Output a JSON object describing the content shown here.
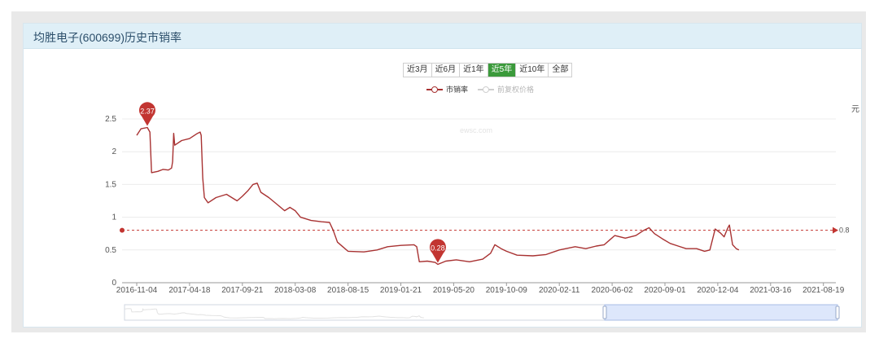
{
  "panel": {
    "title": "均胜电子(600699)历史市销率"
  },
  "range_buttons": [
    {
      "label": "近3月",
      "active": false
    },
    {
      "label": "近6月",
      "active": false
    },
    {
      "label": "近1年",
      "active": false
    },
    {
      "label": "近5年",
      "active": true
    },
    {
      "label": "近10年",
      "active": false
    },
    {
      "label": "全部",
      "active": false
    }
  ],
  "legend": [
    {
      "label": "市销率",
      "active": true
    },
    {
      "label": "前复权价格",
      "active": false
    }
  ],
  "right_axis_unit": "元",
  "watermark": "ewsc.com",
  "colors": {
    "series": "#a83232",
    "marker": "#c23531",
    "inactive": "#cfcfcf",
    "active_button": "#3b9a3b",
    "selection": "#dde7fb"
  },
  "chart_data": {
    "type": "line",
    "ylim": [
      0,
      2.5
    ],
    "y_ticks": [
      "0",
      "0.5",
      "1",
      "1.5",
      "2",
      "2.5"
    ],
    "x_ticks": [
      "2016-11-04",
      "2017-04-18",
      "2017-09-21",
      "2018-03-08",
      "2018-08-15",
      "2019-01-21",
      "2019-05-20",
      "2019-10-09",
      "2020-02-11",
      "2020-06-02",
      "2020-09-01",
      "2020-12-04",
      "2021-03-16",
      "2021-08-19"
    ],
    "series": [
      {
        "name": "市销率",
        "points": [
          [
            0,
            2.25
          ],
          [
            0.08,
            2.35
          ],
          [
            0.2,
            2.37
          ],
          [
            0.25,
            2.3
          ],
          [
            0.28,
            1.68
          ],
          [
            0.4,
            1.7
          ],
          [
            0.5,
            1.73
          ],
          [
            0.6,
            1.72
          ],
          [
            0.66,
            1.75
          ],
          [
            0.68,
            1.85
          ],
          [
            0.7,
            2.28
          ],
          [
            0.72,
            2.1
          ],
          [
            0.85,
            2.17
          ],
          [
            1.0,
            2.2
          ],
          [
            1.15,
            2.28
          ],
          [
            1.2,
            2.3
          ],
          [
            1.22,
            2.25
          ],
          [
            1.25,
            1.6
          ],
          [
            1.28,
            1.3
          ],
          [
            1.35,
            1.22
          ],
          [
            1.5,
            1.3
          ],
          [
            1.7,
            1.35
          ],
          [
            1.8,
            1.3
          ],
          [
            1.9,
            1.25
          ],
          [
            2.0,
            1.32
          ],
          [
            2.1,
            1.4
          ],
          [
            2.2,
            1.5
          ],
          [
            2.28,
            1.52
          ],
          [
            2.35,
            1.38
          ],
          [
            2.5,
            1.3
          ],
          [
            2.65,
            1.2
          ],
          [
            2.8,
            1.1
          ],
          [
            2.9,
            1.15
          ],
          [
            3.0,
            1.1
          ],
          [
            3.1,
            1.0
          ],
          [
            3.3,
            0.95
          ],
          [
            3.5,
            0.93
          ],
          [
            3.65,
            0.92
          ],
          [
            3.72,
            0.8
          ],
          [
            3.8,
            0.62
          ],
          [
            3.9,
            0.55
          ],
          [
            4.0,
            0.48
          ],
          [
            4.3,
            0.47
          ],
          [
            4.55,
            0.5
          ],
          [
            4.75,
            0.55
          ],
          [
            5.0,
            0.57
          ],
          [
            5.25,
            0.58
          ],
          [
            5.3,
            0.55
          ],
          [
            5.35,
            0.32
          ],
          [
            5.5,
            0.33
          ],
          [
            5.65,
            0.31
          ],
          [
            5.7,
            0.28
          ],
          [
            5.85,
            0.33
          ],
          [
            6.05,
            0.35
          ],
          [
            6.3,
            0.32
          ],
          [
            6.55,
            0.36
          ],
          [
            6.7,
            0.45
          ],
          [
            6.78,
            0.58
          ],
          [
            6.9,
            0.52
          ],
          [
            7.0,
            0.48
          ],
          [
            7.2,
            0.42
          ],
          [
            7.5,
            0.41
          ],
          [
            7.75,
            0.43
          ],
          [
            8.0,
            0.5
          ],
          [
            8.3,
            0.55
          ],
          [
            8.5,
            0.52
          ],
          [
            8.7,
            0.56
          ],
          [
            8.85,
            0.58
          ],
          [
            8.95,
            0.65
          ],
          [
            9.05,
            0.72
          ],
          [
            9.25,
            0.68
          ],
          [
            9.45,
            0.72
          ],
          [
            9.6,
            0.8
          ],
          [
            9.7,
            0.84
          ],
          [
            9.8,
            0.75
          ],
          [
            9.95,
            0.67
          ],
          [
            10.1,
            0.6
          ],
          [
            10.25,
            0.56
          ],
          [
            10.4,
            0.52
          ],
          [
            10.6,
            0.52
          ],
          [
            10.75,
            0.48
          ],
          [
            10.85,
            0.5
          ],
          [
            10.95,
            0.82
          ],
          [
            11.05,
            0.76
          ],
          [
            11.12,
            0.7
          ],
          [
            11.18,
            0.82
          ],
          [
            11.22,
            0.88
          ],
          [
            11.28,
            0.58
          ],
          [
            11.35,
            0.52
          ],
          [
            11.4,
            0.5
          ]
        ]
      }
    ],
    "max_marker": {
      "x": 0.2,
      "value": 2.37,
      "label": "2.37"
    },
    "min_marker": {
      "x": 5.7,
      "value": 0.28,
      "label": "0.28"
    },
    "reference_line": {
      "value": 0.8,
      "label": "0.8"
    },
    "grid": true,
    "legend_position": "top-center"
  }
}
